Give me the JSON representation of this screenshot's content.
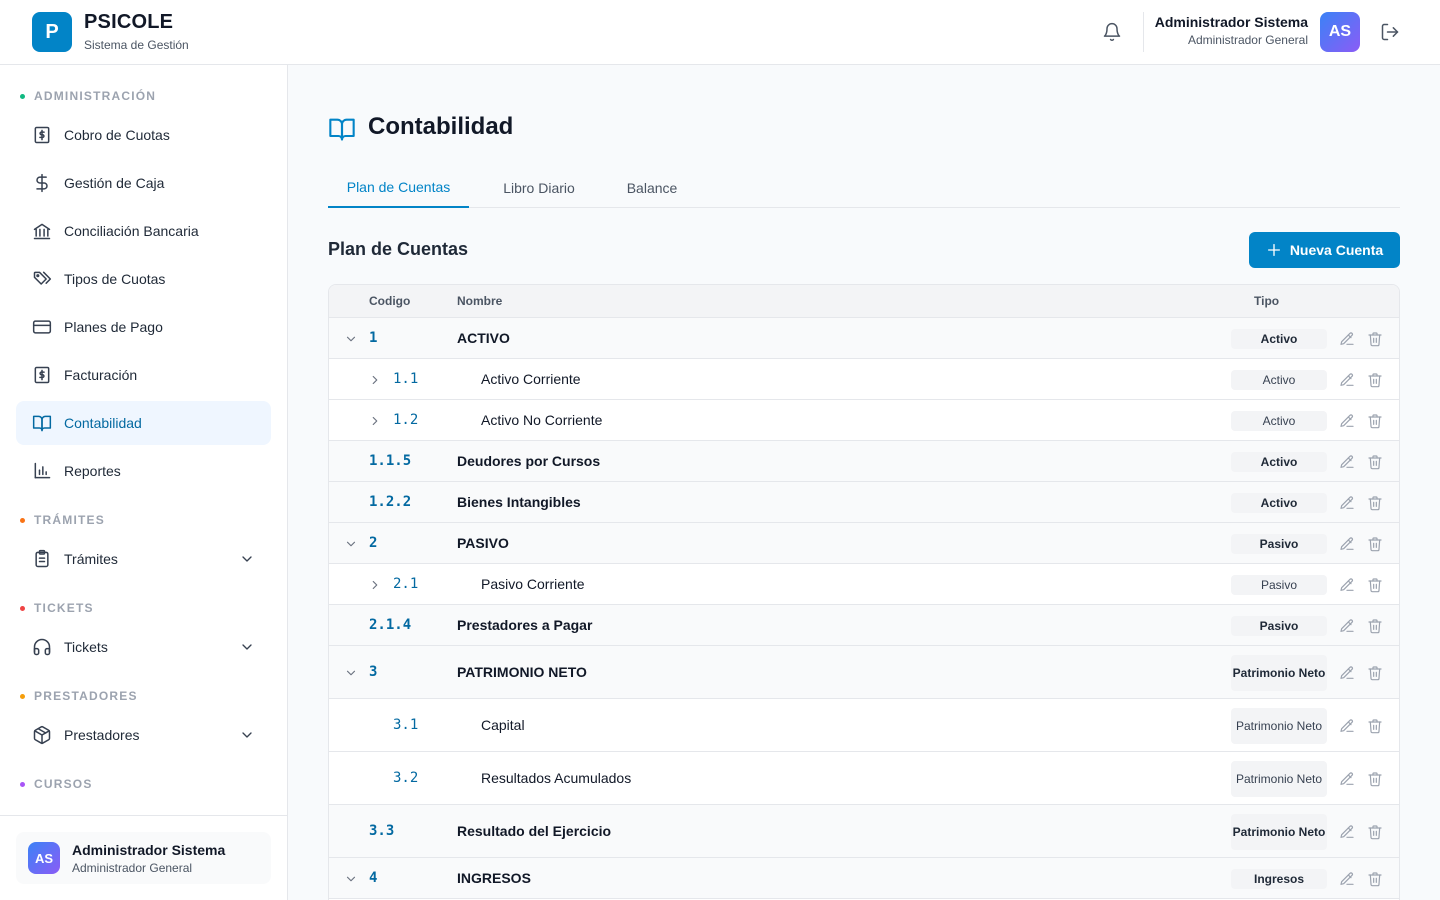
{
  "header": {
    "logo_letter": "P",
    "app_name": "PSICOLE",
    "app_subtitle": "Sistema de Gestión",
    "user_name": "Administrador Sistema",
    "user_role": "Administrador General",
    "avatar_initials": "AS",
    "icons": [
      "bell-icon",
      "logout-icon"
    ]
  },
  "sidebar": {
    "sections": [
      {
        "label": "ADMINISTRACIÓN",
        "color": "#10b981"
      },
      {
        "label": "TRÁMITES",
        "color": "#f97316"
      },
      {
        "label": "TICKETS",
        "color": "#ef4444"
      },
      {
        "label": "PRESTADORES",
        "color": "#f59e0b"
      },
      {
        "label": "CURSOS",
        "color": "#a855f7"
      }
    ],
    "items": [
      {
        "label": "Cobro de Cuotas",
        "icon": "receipt-dollar-icon"
      },
      {
        "label": "Gestión de Caja",
        "icon": "dollar-icon"
      },
      {
        "label": "Conciliación Bancaria",
        "icon": "bank-icon"
      },
      {
        "label": "Tipos de Cuotas",
        "icon": "tags-icon"
      },
      {
        "label": "Planes de Pago",
        "icon": "credit-card-icon"
      },
      {
        "label": "Facturación",
        "icon": "invoice-icon"
      },
      {
        "label": "Contabilidad",
        "icon": "book-open-icon",
        "active": true
      },
      {
        "label": "Reportes",
        "icon": "bar-chart-icon"
      },
      {
        "label": "Trámites",
        "icon": "clipboard-icon"
      },
      {
        "label": "Tickets",
        "icon": "headphones-icon"
      },
      {
        "label": "Prestadores",
        "icon": "package-icon"
      }
    ],
    "footer": {
      "initials": "AS",
      "name": "Administrador Sistema",
      "role": "Administrador General"
    }
  },
  "main": {
    "title": "Contabilidad",
    "tabs": [
      "Plan de Cuentas",
      "Libro Diario",
      "Balance"
    ],
    "active_tab": "Plan de Cuentas",
    "section_title": "Plan de Cuentas",
    "new_button": "Nueva Cuenta",
    "accent_color": "#0284c7"
  },
  "table": {
    "columns": [
      "Codigo",
      "Nombre",
      "Tipo"
    ],
    "rows": [
      {
        "code": "1",
        "name": "ACTIVO",
        "type": "Activo",
        "toggle": "expanded",
        "level": 0
      },
      {
        "code": "1.1",
        "name": "Activo Corriente",
        "type": "Activo",
        "toggle": "collapsed",
        "level": 1
      },
      {
        "code": "1.2",
        "name": "Activo No Corriente",
        "type": "Activo",
        "toggle": "collapsed",
        "level": 1
      },
      {
        "code": "1.1.5",
        "name": "Deudores por Cursos",
        "type": "Activo",
        "toggle": "none",
        "level": 0
      },
      {
        "code": "1.2.2",
        "name": "Bienes Intangibles",
        "type": "Activo",
        "toggle": "none",
        "level": 0
      },
      {
        "code": "2",
        "name": "PASIVO",
        "type": "Pasivo",
        "toggle": "expanded",
        "level": 0
      },
      {
        "code": "2.1",
        "name": "Pasivo Corriente",
        "type": "Pasivo",
        "toggle": "collapsed",
        "level": 1
      },
      {
        "code": "2.1.4",
        "name": "Prestadores a Pagar",
        "type": "Pasivo",
        "toggle": "none",
        "level": 0
      },
      {
        "code": "3",
        "name": "PATRIMONIO NETO",
        "type": "Patrimonio Neto",
        "toggle": "expanded",
        "level": 0
      },
      {
        "code": "3.1",
        "name": "Capital",
        "type": "Patrimonio Neto",
        "toggle": "none",
        "level": 1
      },
      {
        "code": "3.2",
        "name": "Resultados Acumulados",
        "type": "Patrimonio Neto",
        "toggle": "none",
        "level": 1
      },
      {
        "code": "3.3",
        "name": "Resultado del Ejercicio",
        "type": "Patrimonio Neto",
        "toggle": "none",
        "level": 0
      },
      {
        "code": "4",
        "name": "INGRESOS",
        "type": "Ingresos",
        "toggle": "expanded",
        "level": 0
      }
    ]
  }
}
